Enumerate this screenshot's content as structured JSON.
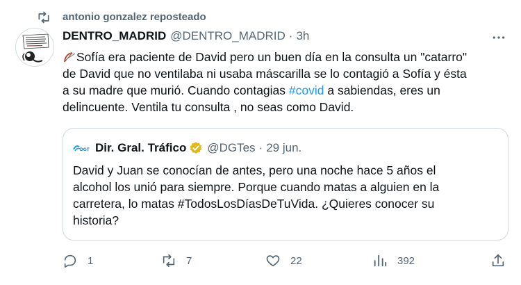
{
  "repost": {
    "text": "antonio gonzalez reposteado"
  },
  "tweet": {
    "author_name": "DENTRO_MADRID",
    "author_handle": "@DENTRO_MADRID",
    "separator": "·",
    "time": "3h",
    "lines": [
      {
        "pre": "Sofía era paciente de David pero un buen día  en la consulta un \"catarro\""
      },
      {
        "pre": "de David que no  ventilaba ni usaba máscarilla se lo contagió a Sofía y ésta"
      },
      {
        "pre": "a su madre que murió. Cuando contagias ",
        "hashtag": "#covid",
        "post": "  a sabiendas, eres un"
      },
      {
        "pre": "delincuente. Ventila tu consulta , no seas como David."
      }
    ]
  },
  "quote": {
    "author_name": "Dir. Gral. Tráfico",
    "author_handle": "@DGTes",
    "separator": "·",
    "time": "29 jun.",
    "logo_text": "DGT",
    "lines": [
      "David y Juan se conocían de antes, pero una noche hace 5 años el",
      "alcohol los unió para siempre. Porque cuando matas a alguien en la",
      "carretera, lo matas #TodosLosDíasDeTuVida. ¿Quieres conocer su",
      "historia?"
    ]
  },
  "actions": {
    "reply_count": "1",
    "repost_count": "7",
    "like_count": "22",
    "views_count": "392"
  },
  "colors": {
    "accent": "#1d9bf0",
    "muted": "#536471",
    "verified_gold": "#e2b719",
    "border": "#cfd9de"
  }
}
